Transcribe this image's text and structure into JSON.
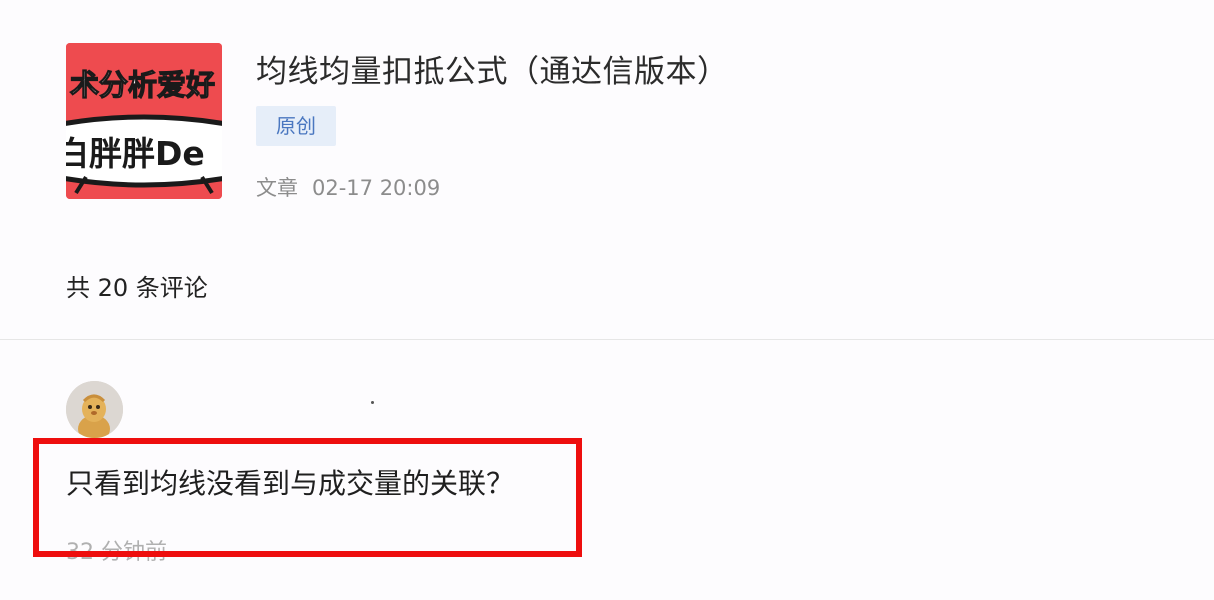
{
  "article": {
    "thumbnail": {
      "line1": "术分析爱好",
      "line2": "白胖胖De",
      "bg_color": "#ee4b4f"
    },
    "title": "均线均量扣抵公式（通达信版本）",
    "badge": "原创",
    "type": "文章",
    "date": "02-17 20:09"
  },
  "comments_header": {
    "count_text": "共 20 条评论"
  },
  "comment": {
    "avatar_icon": "user-avatar",
    "text": "只看到均线没看到与成交量的关联？",
    "time": "32 分钟前",
    "highlight_color": "#ee0e0e"
  }
}
